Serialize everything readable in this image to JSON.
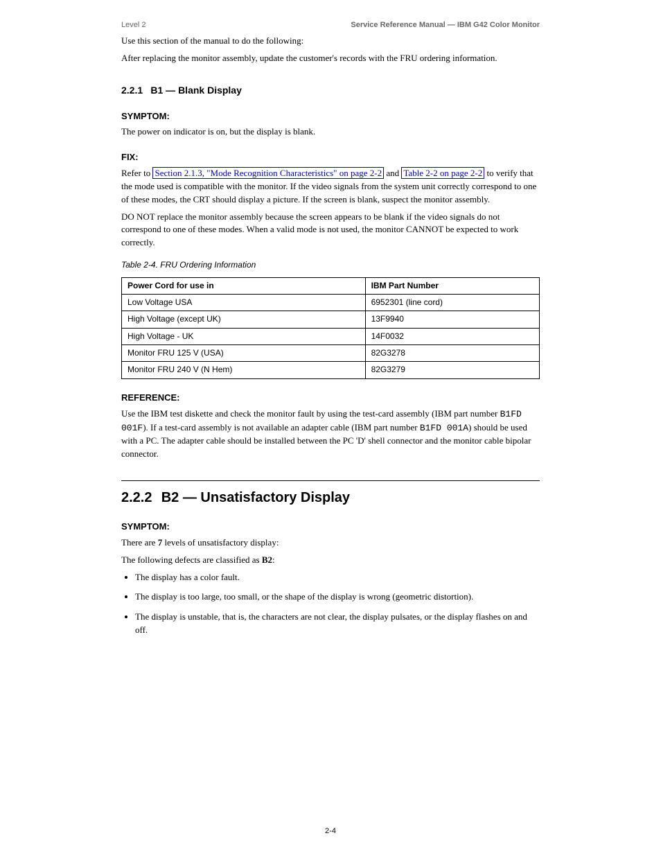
{
  "header": {
    "left": "Level 2",
    "right": "Service Reference Manual — IBM G42 Color Monitor"
  },
  "intro": "Use this section of the manual to do the following:",
  "replacing_line": "After replacing the monitor assembly, update the customer's records with the FRU ordering information.",
  "sections": {
    "s221": {
      "num": "2.2.1",
      "title": "B1 — Blank Display"
    },
    "s222": {
      "num": "2.2.2",
      "title": "B2 — Unsatisfactory Display"
    }
  },
  "blocks": {
    "symptom": "SYMPTOM:",
    "fix": "FIX:",
    "reference": "REFERENCE:"
  },
  "b1": {
    "symptom_text": "The power on indicator is on, but the display is blank.",
    "fix_p1_a": "Refer to ",
    "fix_p1_link": "Section 2.1.3, \"Mode Recognition Characteristics\" on page 2-2",
    "fix_p1_b": " and ",
    "fix_p2_link": "Table 2-2 on page 2-2",
    "fix_p2_b": " to verify that the mode used is compatible with the monitor. If the video signals from the system unit correctly correspond to one of these modes, the CRT should display a picture. If the screen is blank, suspect the monitor assembly.",
    "fix_p3": "DO NOT replace the monitor assembly because the screen appears to be blank if the video signals do not correspond to one of these modes. When a valid mode is not used, the monitor CANNOT be expected to work correctly.",
    "table_caption": "Table 2-4. FRU Ordering Information",
    "table": {
      "headers": [
        "Power Cord for use in",
        "IBM Part Number"
      ],
      "rows": [
        [
          "Low Voltage USA",
          "6952301 (line cord)"
        ],
        [
          "High Voltage (except UK)",
          "13F9940"
        ],
        [
          "High Voltage - UK",
          "14F0032"
        ],
        [
          "Monitor FRU 125 V (USA)",
          "82G3278"
        ],
        [
          "Monitor FRU 240 V (N Hem)",
          "82G3279"
        ]
      ]
    },
    "ref_p1_a": "Use the IBM test diskette and check the monitor fault by using the test-card assembly (IBM part number ",
    "ref_p1_mono": "B1FD 001F",
    "ref_p1_b": "). If a test-card assembly is not available an adapter cable (IBM part number ",
    "ref_p1_mono2": "B1FD 001A",
    "ref_p1_c": ") should be used with a PC. The adapter cable should be installed between the PC 'D' shell connector and the monitor cable bipolar connector."
  },
  "b2": {
    "lead_a": "There are ",
    "lead_bold": "7",
    "lead_b": " levels of unsatisfactory display:",
    "intro": "The following defects are classified as ",
    "intro_bold": "B2",
    "intro_b": ":",
    "bullets": [
      "The display has a color fault.",
      "The display is too large, too small, or the shape of the display is wrong (geometric distortion).",
      "The display is unstable, that is, the characters are not clear, the display pulsates, or the display flashes on and off."
    ]
  },
  "page_num": "2-4"
}
